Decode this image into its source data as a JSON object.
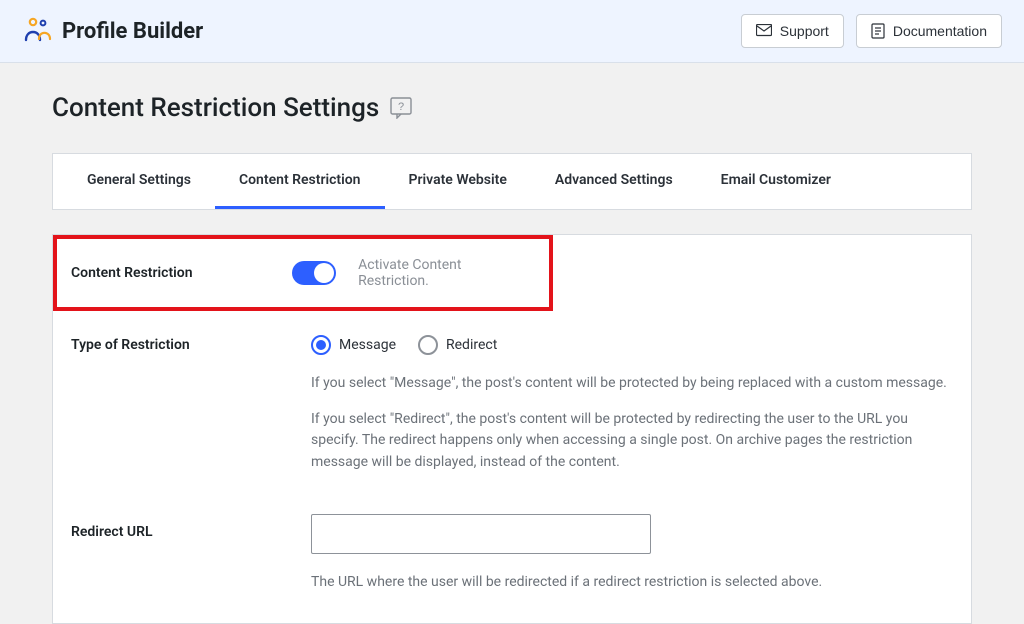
{
  "header": {
    "brand": "Profile Builder",
    "support_label": "Support",
    "documentation_label": "Documentation"
  },
  "page": {
    "title": "Content Restriction Settings"
  },
  "tabs": [
    {
      "label": "General Settings",
      "active": false
    },
    {
      "label": "Content Restriction",
      "active": true
    },
    {
      "label": "Private Website",
      "active": false
    },
    {
      "label": "Advanced Settings",
      "active": false
    },
    {
      "label": "Email Customizer",
      "active": false
    }
  ],
  "settings": {
    "content_restriction": {
      "label": "Content Restriction",
      "toggle_on": true,
      "description": "Activate Content Restriction."
    },
    "type_of_restriction": {
      "label": "Type of Restriction",
      "options": {
        "message": "Message",
        "redirect": "Redirect"
      },
      "selected": "message",
      "help_message": "If you select \"Message\", the post's content will be protected by being replaced with a custom message.",
      "help_redirect": "If you select \"Redirect\", the post's content will be protected by redirecting the user to the URL you specify. The redirect happens only when accessing a single post. On archive pages the restriction message will be displayed, instead of the content."
    },
    "redirect_url": {
      "label": "Redirect URL",
      "value": "",
      "help": "The URL where the user will be redirected if a redirect restriction is selected above."
    }
  }
}
